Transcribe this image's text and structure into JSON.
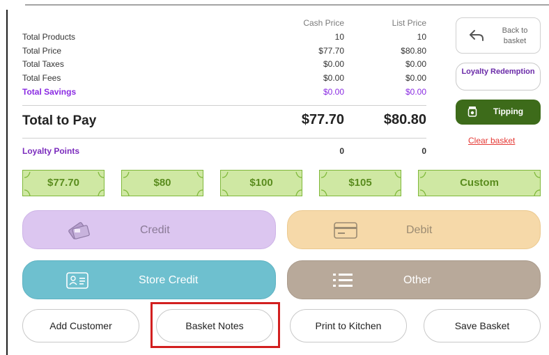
{
  "summary": {
    "col_cash": "Cash Price",
    "col_list": "List Price",
    "rows": [
      {
        "label": "Total Products",
        "cash": "10",
        "list": "10"
      },
      {
        "label": "Total Price",
        "cash": "$77.70",
        "list": "$80.80"
      },
      {
        "label": "Total Taxes",
        "cash": "$0.00",
        "list": "$0.00"
      },
      {
        "label": "Total Fees",
        "cash": "$0.00",
        "list": "$0.00"
      },
      {
        "label": "Total Savings",
        "cash": "$0.00",
        "list": "$0.00"
      }
    ],
    "total": {
      "label": "Total to Pay",
      "cash": "$77.70",
      "list": "$80.80"
    },
    "loyalty": {
      "label": "Loyalty Points",
      "cash": "0",
      "list": "0"
    }
  },
  "side": {
    "back_label": "Back to basket",
    "loyalty_label": "Loyalty Redemption",
    "tipping_label": "Tipping",
    "clear_label": "Clear basket"
  },
  "bills": [
    "$77.70",
    "$80",
    "$100",
    "$105",
    "Custom"
  ],
  "payments": {
    "credit": "Credit",
    "debit": "Debit",
    "store_credit": "Store Credit",
    "other": "Other"
  },
  "bottom": {
    "add_customer": "Add Customer",
    "basket_notes": "Basket Notes",
    "print_kitchen": "Print to Kitchen",
    "save_basket": "Save Basket"
  },
  "colors": {
    "purple": "#8a2be2",
    "tipping_green": "#3d6b1a",
    "bill_green": "#cfe8a3",
    "highlight_red": "#d21f1f"
  }
}
